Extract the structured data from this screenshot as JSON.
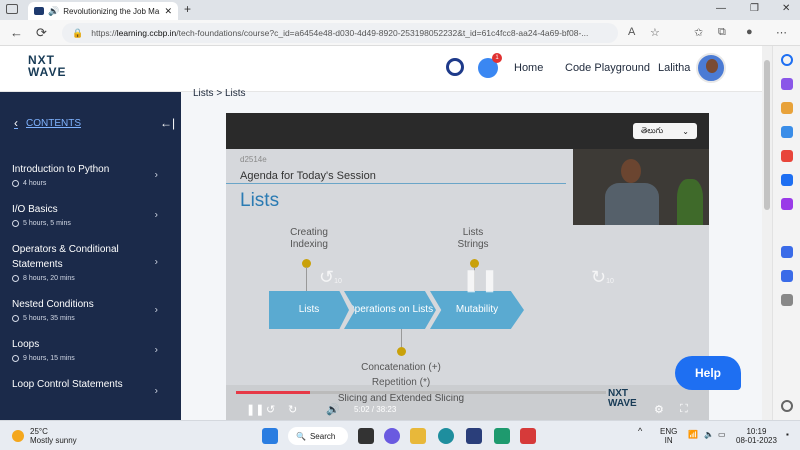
{
  "browser": {
    "tab_title": "Revolutionizing the Job Ma",
    "url_prefix": "https://",
    "url_domain": "learning.ccbp.in",
    "url_rest": "/tech-foundations/course?c_id=a6454e48-d030-4d49-8920-253198052232&t_id=61c4fcc8-aa24-4a69-bf08-..."
  },
  "header": {
    "logo_line1": "NXT",
    "logo_line2": "WAVE",
    "home": "Home",
    "code_playground": "Code Playground",
    "user_name": "Lalitha",
    "notif_count": "1"
  },
  "sidebar": {
    "contents_label": "CONTENTS",
    "items": [
      {
        "name": "Introduction to Python",
        "duration": "4 hours"
      },
      {
        "name": "I/O Basics",
        "duration": "5 hours, 5 mins"
      },
      {
        "name": "Operators & Conditional Statements",
        "duration": "8 hours, 20 mins"
      },
      {
        "name": "Nested Conditions",
        "duration": "5 hours, 35 mins"
      },
      {
        "name": "Loops",
        "duration": "9 hours, 15 mins"
      },
      {
        "name": "Loop Control Statements",
        "duration": ""
      }
    ]
  },
  "main": {
    "breadcrumb": "Lists > Lists",
    "language": "తెలుగు",
    "slide": {
      "code": "d2514e",
      "agenda": "Agenda for Today's Session",
      "title": "Lists",
      "top_left": [
        "Creating",
        "Indexing"
      ],
      "top_right": [
        "Lists",
        "Strings"
      ],
      "boxes": [
        "Lists",
        "Operations on Lists",
        "Mutability"
      ],
      "bottom": [
        "Concatenation (+)",
        "Repetition (*)",
        "Slicing and Extended Slicing"
      ],
      "skip_back": "10",
      "skip_fwd": "10"
    },
    "player": {
      "current_time": "5:02",
      "total_time": "38:23",
      "progress": 0.2
    },
    "watermark_line1": "NXT",
    "watermark_line2": "WAVE"
  },
  "help_label": "Help",
  "taskbar": {
    "temp": "25°C",
    "weather": "Mostly sunny",
    "search": "Search",
    "lang_line1": "ENG",
    "lang_line2": "IN",
    "time": "10:19",
    "date": "08-01-2023"
  }
}
